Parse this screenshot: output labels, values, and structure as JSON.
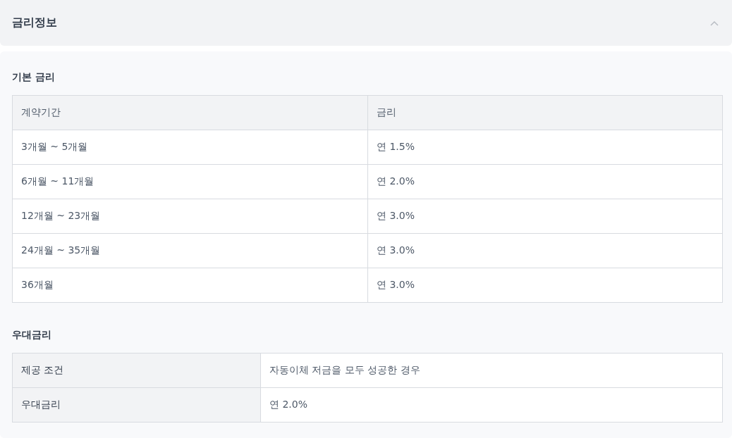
{
  "section": {
    "title": "금리정보",
    "expanded": true
  },
  "base_rate": {
    "heading": "기본 금리",
    "columns": [
      "계약기간",
      "금리"
    ],
    "rows": [
      [
        "3개월 ~ 5개월",
        "연 1.5%"
      ],
      [
        "6개월 ~ 11개월",
        "연 2.0%"
      ],
      [
        "12개월 ~ 23개월",
        "연 3.0%"
      ],
      [
        "24개월 ~ 35개월",
        "연 3.0%"
      ],
      [
        "36개월",
        "연 3.0%"
      ]
    ]
  },
  "preferential_rate": {
    "heading": "우대금리",
    "rows": [
      {
        "label": "제공 조건",
        "value": "자동이체 저금을 모두 성공한 경우"
      },
      {
        "label": "우대금리",
        "value": "연 2.0%"
      }
    ]
  }
}
